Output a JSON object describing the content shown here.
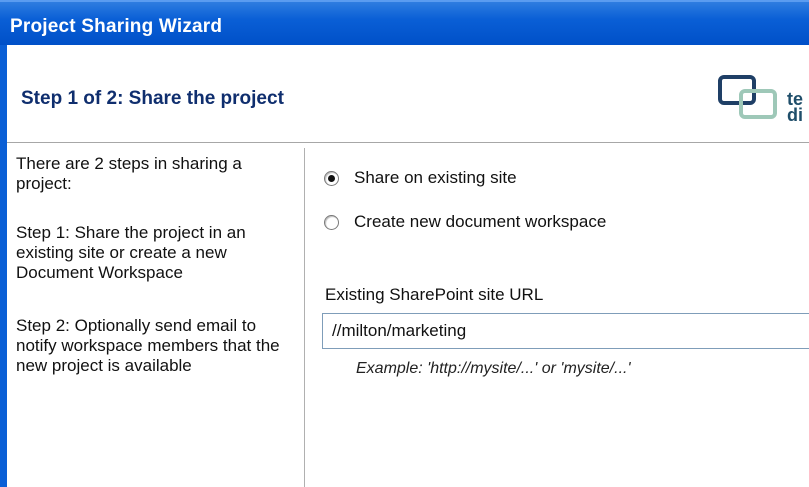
{
  "window": {
    "title": "Project Sharing Wizard"
  },
  "header": {
    "step_title": "Step 1 of 2:  Share the project",
    "logo_text_line1": "te",
    "logo_text_line2": "di"
  },
  "left_pane": {
    "intro": "There are 2 steps in sharing a project:",
    "step1": "Step 1: Share the project in an existing site or create a new Document Workspace",
    "step2": "Step 2: Optionally send email to notify workspace members that the new project is available"
  },
  "options": {
    "share_existing": "Share on existing site",
    "create_new": "Create new document workspace",
    "selected": "share_existing"
  },
  "url_field": {
    "label": "Existing SharePoint site URL",
    "value": "//milton/marketing",
    "example": "Example:  'http://mysite/...' or 'mysite/...'"
  },
  "colors": {
    "titlebar": "#0a5fd6",
    "step_title": "#0f2e6e",
    "logo_dark": "#1f4e6a",
    "logo_light": "#9ec8b8"
  }
}
